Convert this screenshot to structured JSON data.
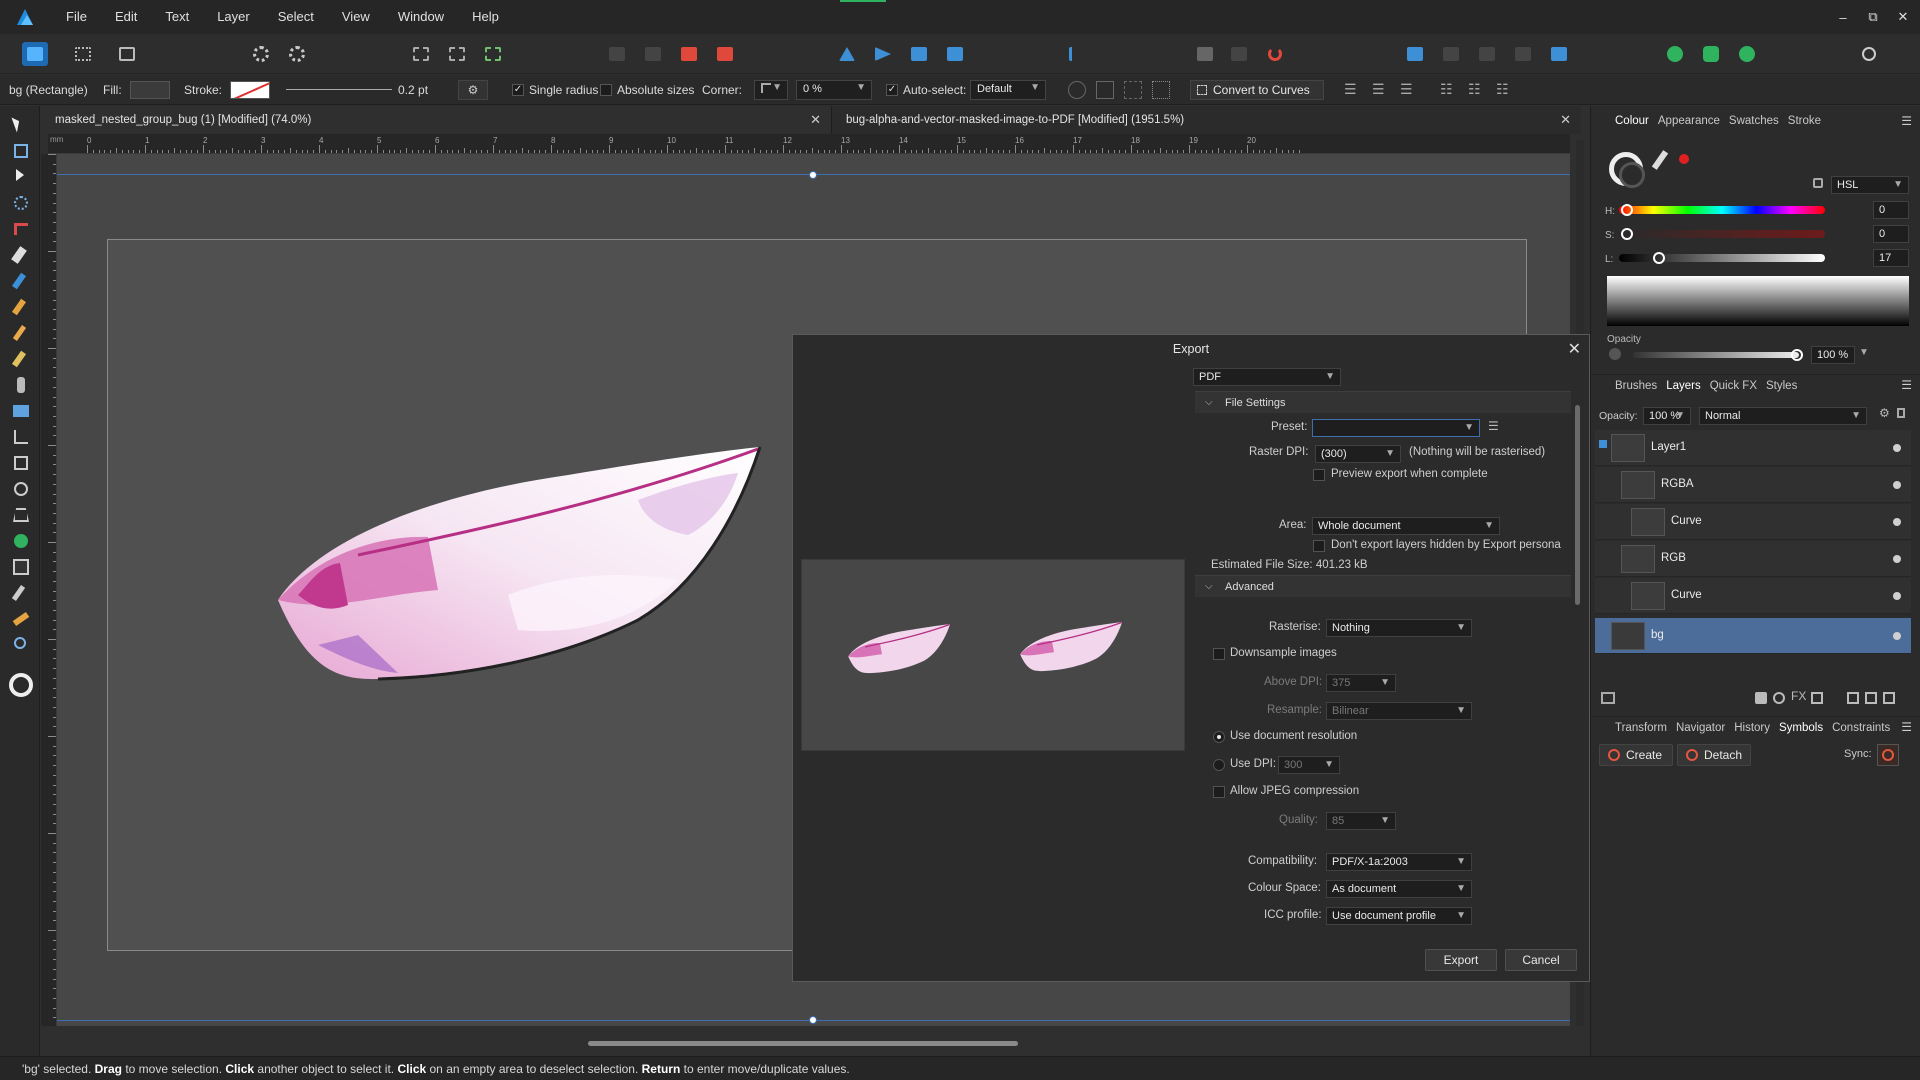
{
  "menu": [
    "File",
    "Edit",
    "Text",
    "Layer",
    "Select",
    "View",
    "Window",
    "Help"
  ],
  "context": {
    "selection": "bg (Rectangle)",
    "fill_label": "Fill:",
    "stroke_label": "Stroke:",
    "stroke_width": "0.2 pt",
    "single_radius": "Single radius",
    "absolute_sizes": "Absolute sizes",
    "corner_label": "Corner:",
    "corner_value": "0 %",
    "auto_select": "Auto-select:",
    "auto_select_value": "Default",
    "convert": "Convert to Curves"
  },
  "documents": [
    {
      "title": "masked_nested_group_bug (1) [Modified] (74.0%)"
    },
    {
      "title": "bug-alpha-and-vector-masked-image-to-PDF [Modified] (1951.5%)"
    }
  ],
  "ruler": {
    "unit": "mm",
    "top_ticks": [
      "0",
      "1",
      "2",
      "3",
      "4",
      "5",
      "6",
      "7",
      "8",
      "9",
      "10",
      "11",
      "12",
      "13",
      "14",
      "15",
      "16",
      "17",
      "18",
      "19",
      "20"
    ]
  },
  "export_dialog": {
    "title": "Export",
    "format": "PDF",
    "file_settings": "File Settings",
    "preset_label": "Preset:",
    "preset_value": "",
    "raster_dpi_label": "Raster DPI:",
    "raster_dpi_value": "(300)",
    "raster_note": "(Nothing will be rasterised)",
    "preview_after": "Preview export when complete",
    "area_label": "Area:",
    "area_value": "Whole document",
    "dont_export_hidden": "Don't export layers hidden by Export persona",
    "estimated_size": "Estimated File Size: 401.23 kB",
    "advanced": "Advanced",
    "rasterise_label": "Rasterise:",
    "rasterise_value": "Nothing",
    "downsample": "Downsample images",
    "above_dpi_label": "Above DPI:",
    "above_dpi_value": "375",
    "resample_label": "Resample:",
    "resample_value": "Bilinear",
    "use_doc_res": "Use document resolution",
    "use_dpi": "Use DPI:",
    "use_dpi_value": "300",
    "allow_jpeg": "Allow JPEG compression",
    "quality_label": "Quality:",
    "quality_value": "85",
    "compat_label": "Compatibility:",
    "compat_value": "PDF/X-1a:2003",
    "colour_space_label": "Colour Space:",
    "colour_space_value": "As document",
    "icc_label": "ICC profile:",
    "icc_value": "Use document profile",
    "export_btn": "Export",
    "cancel_btn": "Cancel"
  },
  "colour_panel": {
    "tabs": [
      "Colour",
      "Appearance",
      "Swatches",
      "Stroke"
    ],
    "model": "HSL",
    "h_label": "H:",
    "h_value": "0",
    "s_label": "S:",
    "s_value": "0",
    "l_label": "L:",
    "l_value": "17",
    "opacity_label": "Opacity",
    "opacity_value": "100 %"
  },
  "layers_panel": {
    "tabs": [
      "Brushes",
      "Layers",
      "Quick FX",
      "Styles"
    ],
    "opacity_label": "Opacity:",
    "opacity_value": "100 %",
    "blend_mode": "Normal",
    "layers": [
      {
        "name": "Layer1"
      },
      {
        "name": "RGBA"
      },
      {
        "name": "Curve"
      },
      {
        "name": "RGB"
      },
      {
        "name": "Curve"
      },
      {
        "name": "bg"
      }
    ]
  },
  "bottom_panel": {
    "tabs": [
      "Transform",
      "Navigator",
      "History",
      "Symbols",
      "Constraints"
    ],
    "create": "Create",
    "detach": "Detach",
    "sync": "Sync:"
  },
  "status": {
    "p1": "'bg' selected. ",
    "b1": "Drag",
    "p2": " to move selection. ",
    "b2": "Click",
    "p3": " another object to select it. ",
    "b3": "Click",
    "p4": " on an empty area to deselect selection. ",
    "b4": "Return",
    "p5": " to enter move/duplicate values."
  },
  "colors": {
    "accent": "#4c6c99",
    "brand": "#1f8ce0",
    "canvas": "#474747"
  }
}
